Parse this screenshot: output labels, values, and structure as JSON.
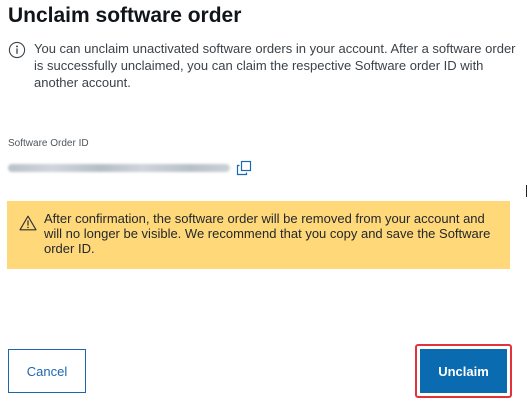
{
  "dialog": {
    "title": "Unclaim software order",
    "info_icon": "info-icon",
    "info_text": "You can unclaim unactivated software orders in your account. After a software order is successfully unclaimed, you can claim the respective Software order ID with another account.",
    "field_label": "Software Order ID",
    "copy_icon": "copy-icon",
    "warning_icon": "warning-triangle-icon",
    "warning_text": "After confirmation, the software order will be removed from your account and will no longer be visible. We recommend that you copy and save the Software order ID.",
    "cancel_label": "Cancel",
    "unclaim_label": "Unclaim"
  },
  "colors": {
    "primary": "#0a6bb0",
    "warning_bg": "#ffd87a",
    "highlight_outline": "#e2323b"
  }
}
